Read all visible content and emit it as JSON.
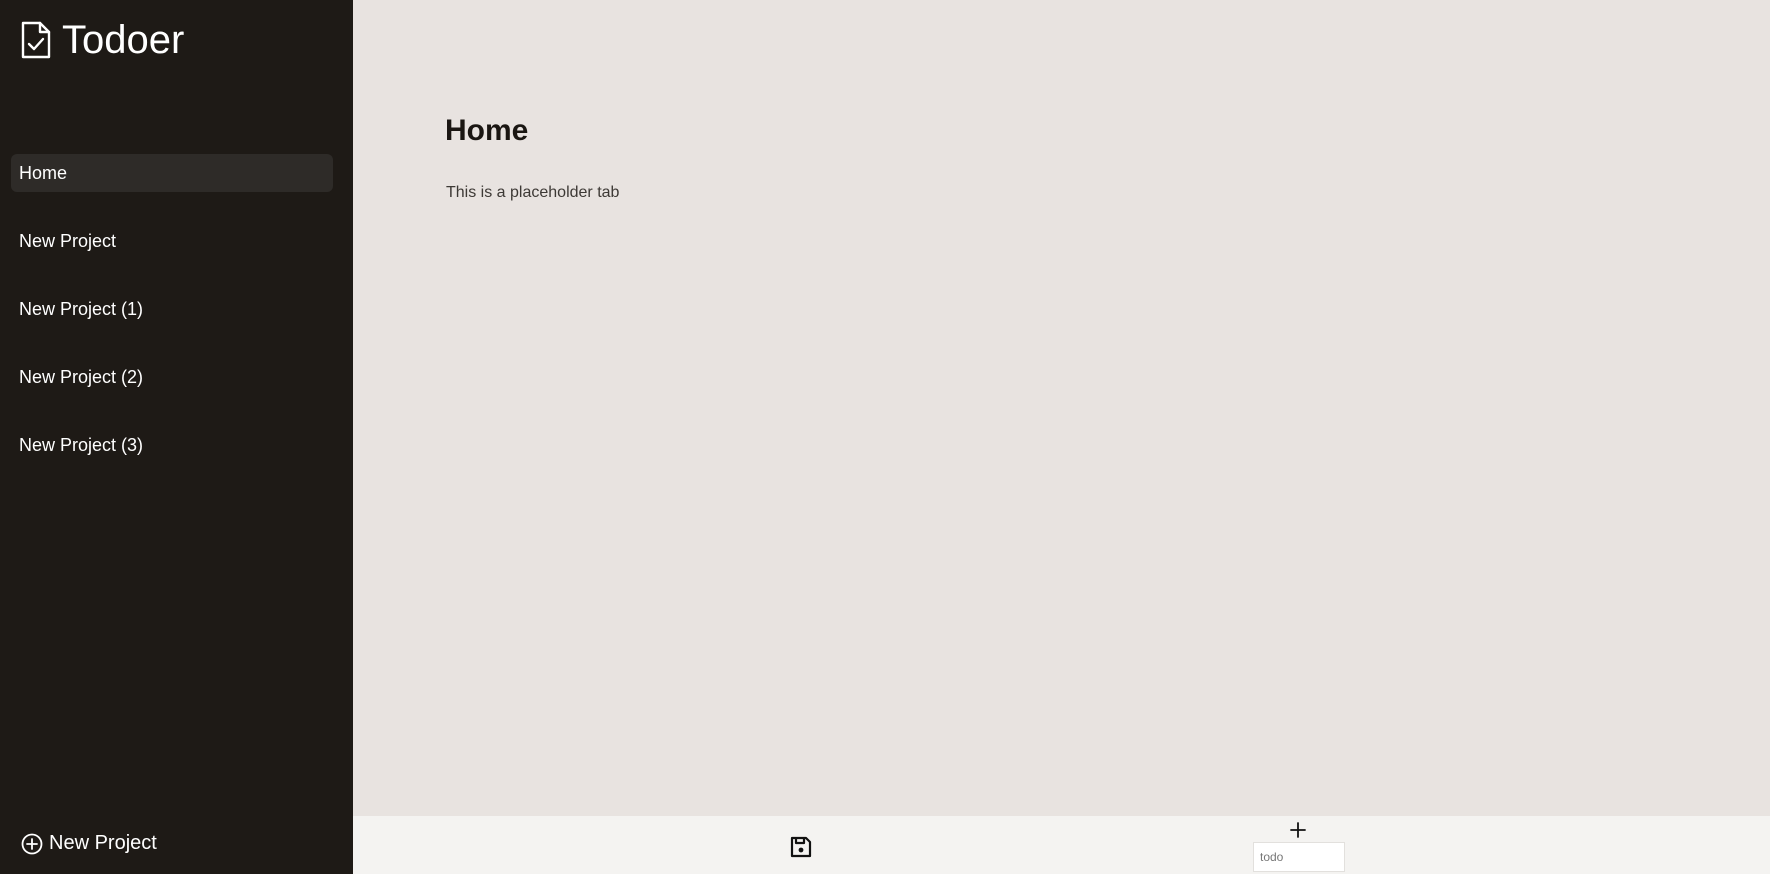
{
  "app": {
    "title": "Todoer",
    "logo_icon": "document-check-icon"
  },
  "sidebar": {
    "items": [
      {
        "label": "Home",
        "active": true
      },
      {
        "label": "New Project",
        "active": false
      },
      {
        "label": "New Project (1)",
        "active": false
      },
      {
        "label": "New Project (2)",
        "active": false
      },
      {
        "label": "New Project (3)",
        "active": false
      }
    ],
    "new_project_label": "New Project",
    "new_project_icon": "plus-circle-icon"
  },
  "main": {
    "title": "Home",
    "text": "This is a placeholder tab"
  },
  "toolbar": {
    "save_icon": "floppy-disk-icon",
    "add_icon": "plus-icon",
    "todo_placeholder": "todo"
  },
  "colors": {
    "sidebar_bg": "#1e1a16",
    "sidebar_active": "#2e2b28",
    "main_bg": "#e8e3e0",
    "toolbar_bg": "#f4f3f1"
  }
}
